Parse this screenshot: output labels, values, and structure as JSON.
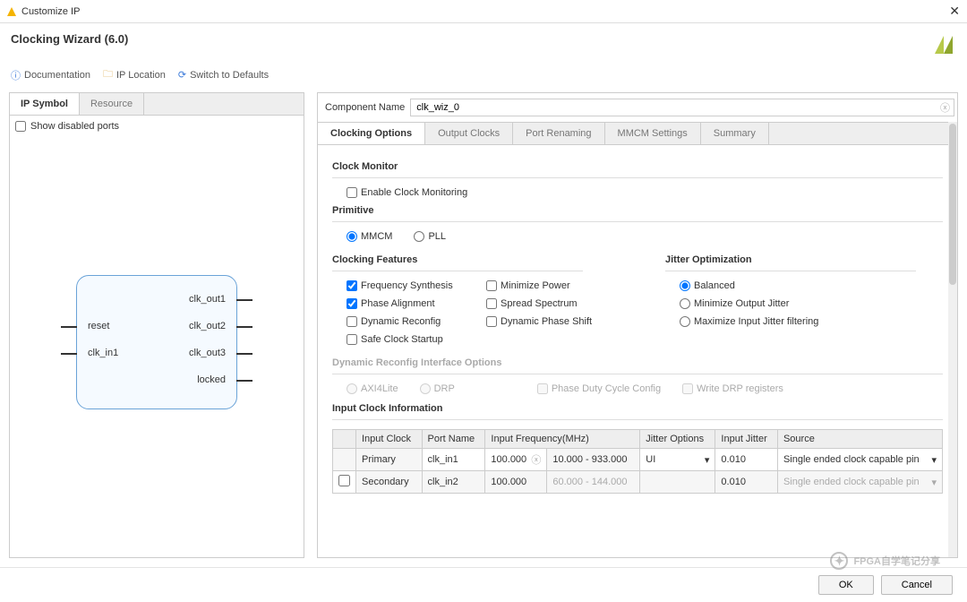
{
  "window": {
    "title": "Customize IP"
  },
  "header": {
    "title": "Clocking Wizard (6.0)"
  },
  "toolbar": {
    "documentation": "Documentation",
    "ip_location": "IP Location",
    "switch_defaults": "Switch to Defaults"
  },
  "left": {
    "tabs": {
      "ip_symbol": "IP Symbol",
      "resource": "Resource"
    },
    "show_disabled": "Show disabled ports",
    "ports": {
      "reset": "reset",
      "clk_in1": "clk_in1",
      "clk_out1": "clk_out1",
      "clk_out2": "clk_out2",
      "clk_out3": "clk_out3",
      "locked": "locked"
    }
  },
  "right": {
    "component_name_label": "Component Name",
    "component_name_value": "clk_wiz_0",
    "subtabs": {
      "clocking_options": "Clocking Options",
      "output_clocks": "Output Clocks",
      "port_renaming": "Port Renaming",
      "mmcm_settings": "MMCM Settings",
      "summary": "Summary"
    },
    "sections": {
      "clock_monitor": "Clock Monitor",
      "enable_clock_monitoring": "Enable Clock Monitoring",
      "primitive": "Primitive",
      "mmcm": "MMCM",
      "pll": "PLL",
      "clocking_features": "Clocking Features",
      "jitter_optimization": "Jitter Optimization",
      "freq_synth": "Frequency Synthesis",
      "min_power": "Minimize Power",
      "phase_align": "Phase Alignment",
      "spread_spectrum": "Spread Spectrum",
      "dyn_reconfig": "Dynamic Reconfig",
      "dyn_phase_shift": "Dynamic Phase Shift",
      "safe_clock": "Safe Clock Startup",
      "balanced": "Balanced",
      "min_out_jitter": "Minimize Output Jitter",
      "max_in_jitter": "Maximize Input Jitter filtering",
      "dyn_reconfig_options": "Dynamic Reconfig Interface Options",
      "axi4lite": "AXI4Lite",
      "drp": "DRP",
      "phase_duty": "Phase Duty Cycle Config",
      "write_drp": "Write DRP registers",
      "input_clock_info": "Input Clock Information"
    },
    "table": {
      "headers": {
        "input_clock": "Input Clock",
        "port_name": "Port Name",
        "input_freq": "Input Frequency(MHz)",
        "jitter_options": "Jitter Options",
        "input_jitter": "Input Jitter",
        "source": "Source"
      },
      "rows": [
        {
          "name": "Primary",
          "port": "clk_in1",
          "freq": "100.000",
          "range": "10.000 - 933.000",
          "jitter_opt": "UI",
          "jitter": "0.010",
          "source": "Single ended clock capable pin",
          "enabled": true,
          "checked": true
        },
        {
          "name": "Secondary",
          "port": "clk_in2",
          "freq": "100.000",
          "range": "60.000 - 144.000",
          "jitter_opt": "",
          "jitter": "0.010",
          "source": "Single ended clock capable pin",
          "enabled": false,
          "checked": false
        }
      ]
    }
  },
  "footer": {
    "ok": "OK",
    "cancel": "Cancel"
  },
  "watermark": "FPGA自学笔记分享"
}
